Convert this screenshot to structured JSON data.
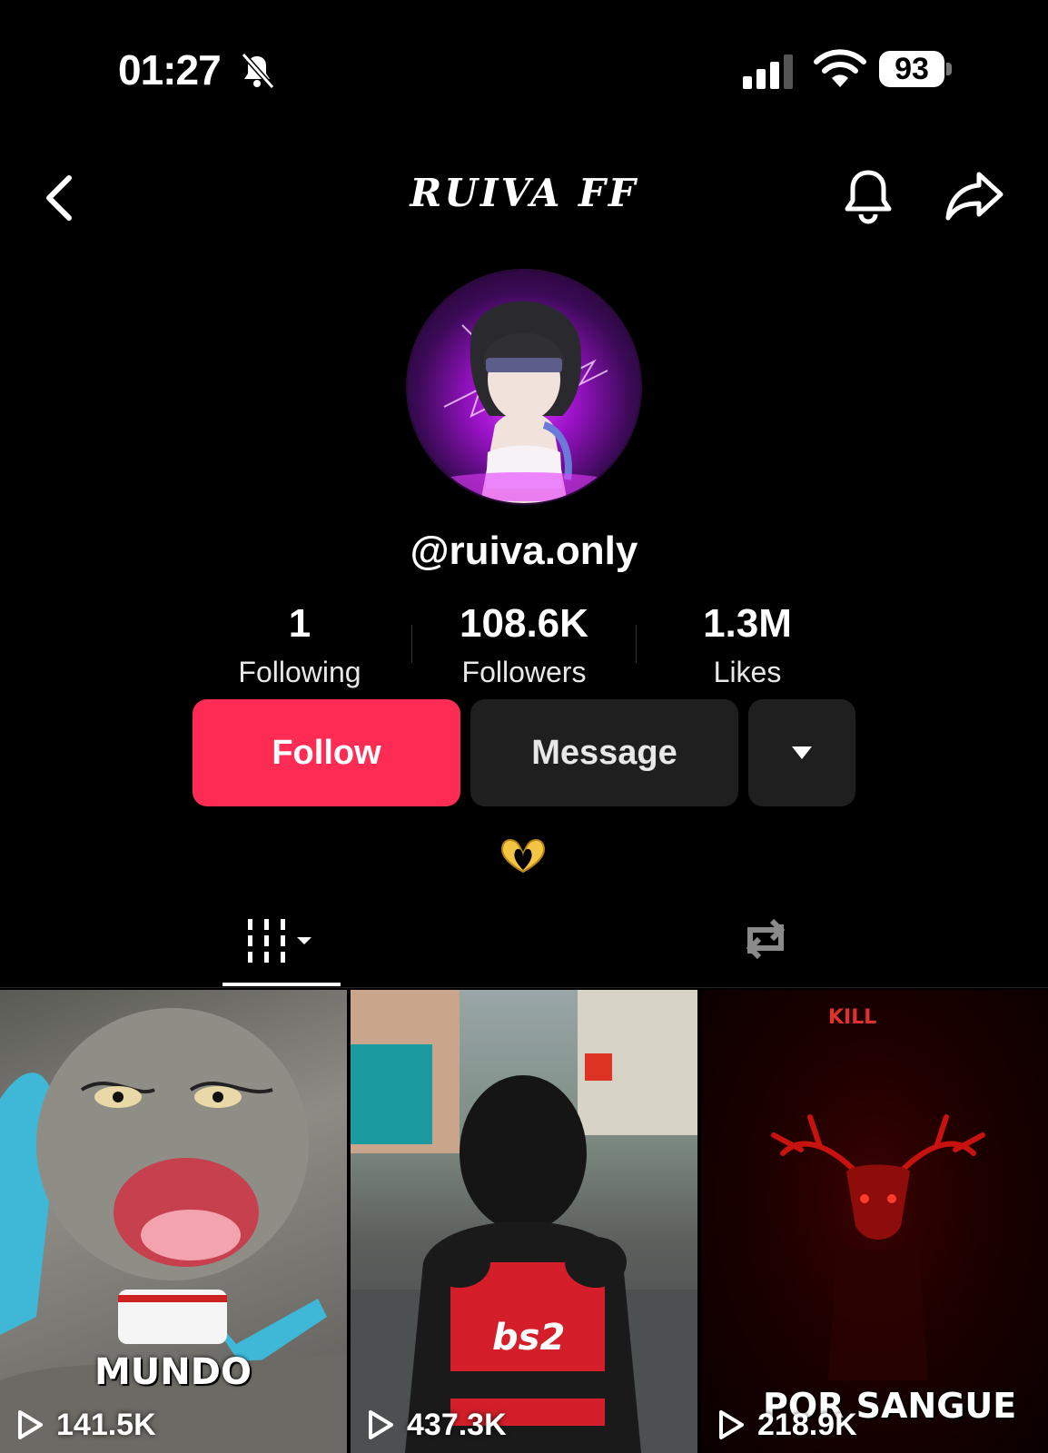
{
  "status_bar": {
    "time": "01:27",
    "battery": "93"
  },
  "header": {
    "title": "RUIVA FF"
  },
  "profile": {
    "handle": "@ruiva.only",
    "stats": [
      {
        "value": "1",
        "label": "Following"
      },
      {
        "value": "108.6K",
        "label": "Followers"
      },
      {
        "value": "1.3M",
        "label": "Likes"
      }
    ],
    "bio": "🫶"
  },
  "actions": {
    "follow": "Follow",
    "message": "Message"
  },
  "videos": [
    {
      "overlay_text": "MUNDO",
      "views": "141.5K"
    },
    {
      "overlay_text": "bs2",
      "views": "437.3K"
    },
    {
      "overlay_text": "POR SANGUE",
      "top_text": "KILL",
      "views": "218.9K"
    }
  ],
  "colors": {
    "accent": "#fe2c55",
    "button_dark": "#1f1f1f",
    "background": "#000000"
  }
}
